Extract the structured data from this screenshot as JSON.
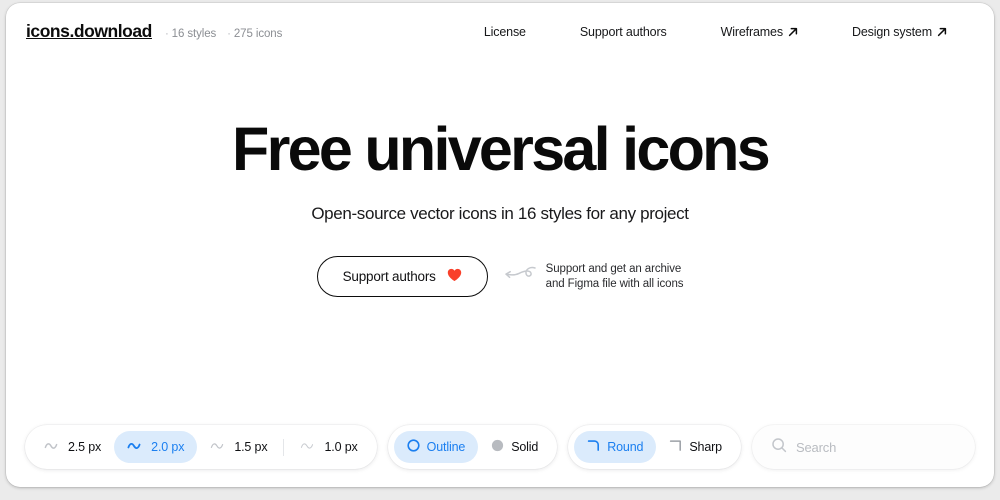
{
  "theme": {
    "accent_blue": "#1b7ff0",
    "accent_blue_bg": "#dbebfc",
    "heart_red": "#f9402a",
    "text_dark": "#0a0a0a",
    "text_muted": "#8b8e93",
    "page_bg": "#ebebeb",
    "card_bg": "#ffffff"
  },
  "header": {
    "logo": "icons.download",
    "meta": [
      {
        "dot": "·",
        "label": "16 styles"
      },
      {
        "dot": "·",
        "label": "275 icons"
      }
    ],
    "nav": [
      {
        "label": "License",
        "external": false
      },
      {
        "label": "Support authors",
        "external": false
      },
      {
        "label": "Wireframes",
        "external": true
      },
      {
        "label": "Design system",
        "external": true
      }
    ]
  },
  "hero": {
    "title": "Free universal icons",
    "subtitle": "Open-source vector icons in 16 styles for any project",
    "cta": {
      "label": "Support authors",
      "icon": "heart-icon"
    },
    "annotation": {
      "arrow_icon": "curly-arrow-left-icon",
      "line1": "Support and get an archive",
      "line2": "and Figma file with all icons"
    }
  },
  "toolbar": {
    "stroke_group": {
      "name": "stroke-width-group",
      "options": [
        {
          "label": "2.5 px",
          "selected": false,
          "icon": "wave-icon",
          "divider_after": false
        },
        {
          "label": "2.0 px",
          "selected": true,
          "icon": "wave-icon",
          "divider_after": false
        },
        {
          "label": "1.5 px",
          "selected": false,
          "icon": "wave-icon",
          "divider_after": true
        },
        {
          "label": "1.0 px",
          "selected": false,
          "icon": "wave-icon",
          "divider_after": false
        }
      ]
    },
    "fill_group": {
      "name": "fill-style-group",
      "options": [
        {
          "label": "Outline",
          "selected": true,
          "icon": "circle-outline-icon"
        },
        {
          "label": "Solid",
          "selected": false,
          "icon": "circle-solid-icon"
        }
      ]
    },
    "corner_group": {
      "name": "corner-style-group",
      "options": [
        {
          "label": "Round",
          "selected": true,
          "icon": "corner-round-icon"
        },
        {
          "label": "Sharp",
          "selected": false,
          "icon": "corner-sharp-icon"
        }
      ]
    },
    "search": {
      "icon": "search-icon",
      "placeholder": "Search",
      "value": ""
    }
  }
}
